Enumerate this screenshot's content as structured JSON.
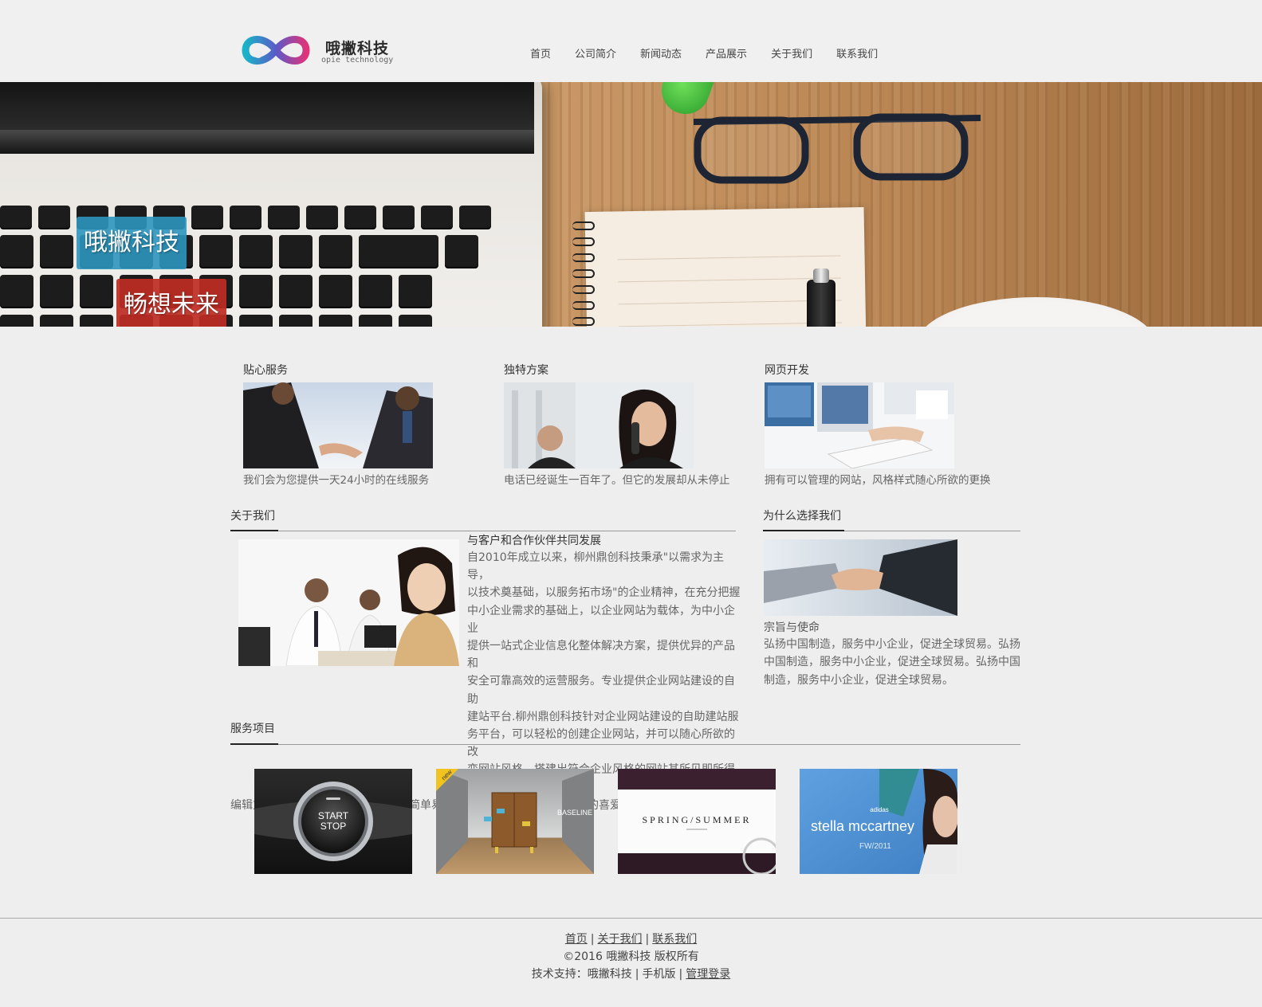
{
  "brand": {
    "name": "哦撇科技",
    "subtitle": "opie technology"
  },
  "nav": [
    "首页",
    "公司简介",
    "新闻动态",
    "产品展示",
    "关于我们",
    "联系我们"
  ],
  "banner": {
    "tag1": "哦撇科技",
    "tag2": "畅想未来"
  },
  "features": [
    {
      "title": "贴心服务",
      "desc": "我们会为您提供一天24小时的在线服务"
    },
    {
      "title": "独特方案",
      "desc": "电话已经诞生一百年了。但它的发展却从未停止"
    },
    {
      "title": "网页开发",
      "desc": "拥有可以管理的网站，风格样式随心所欲的更换"
    }
  ],
  "about": {
    "title": "关于我们",
    "heading": "与客户和合作伙伴共同发展",
    "lines": [
      "自2010年成立以来，柳州鼎创科技秉承\"以需求为主导，",
      "以技术奠基础，以服务拓市场\"的企业精神，在充分把握",
      "中小企业需求的基础上，以企业网站为载体，为中小企业",
      "提供一站式企业信息化整体解决方案，提供优异的产品和",
      "安全可靠高效的运营服务。专业提供企业网站建设的自助",
      "建站平台.柳州鼎创科技针对企业网站建设的自助建站服",
      "务平台，可以轻松的创建企业网站，并可以随心所欲的改",
      "变网站风格，搭建出符合企业风格的网站其所见即所得的"
    ],
    "last_line": "编辑方式是本平台的最大风格，并以简单易用、功能强大而深受中小企业的喜爱。"
  },
  "why": {
    "title": "为什么选择我们",
    "heading": "宗旨与使命",
    "text": "弘扬中国制造，服务中小企业，促进全球贸易。弘扬中国制造，服务中小企业，促进全球贸易。弘扬中国制造，服务中小企业，促进全球贸易。"
  },
  "services": {
    "title": "服务项目",
    "items": [
      {
        "label_top": "START",
        "label_bottom": "STOP"
      },
      {
        "label": "BASELINE",
        "corner": "new"
      },
      {
        "label": "SPRING/SUMMER"
      },
      {
        "brand": "adidas",
        "label": "stella mccartney",
        "sub": "FW/2011"
      }
    ]
  },
  "footer": {
    "links": [
      "首页",
      "关于我们",
      "联系我们"
    ],
    "copyright": "©2016 哦撇科技 版权所有",
    "support_prefix": "技术支持：",
    "support_name": "哦撇科技",
    "mobile": "手机版",
    "admin": "管理登录"
  }
}
